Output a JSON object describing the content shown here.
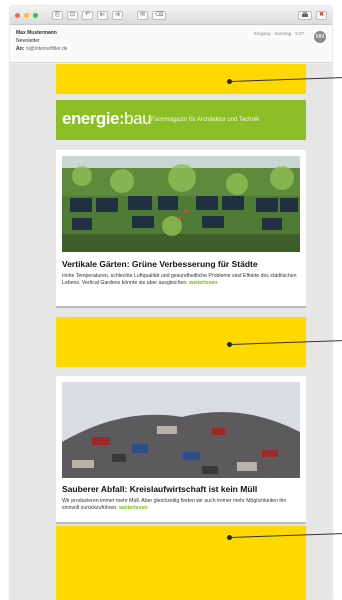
{
  "toolbar": {
    "lights": [
      "#ff5f57",
      "#ffbd2e",
      "#28c940"
    ],
    "buttons": [
      "⎘",
      "⊡",
      "↶",
      "⇇",
      "⇉",
      "✉",
      "⌫"
    ],
    "print_icon": "print-icon",
    "delete_icon": "delete-icon"
  },
  "header": {
    "sender": "Max Mustermann",
    "subject": "Newsletter",
    "to_label": "An:",
    "to_value": "ni@internetfilter.de",
    "meta": "Eingang · Sonntag · 9:37",
    "avatar": "MM"
  },
  "banner": {
    "logo_bold": "energie",
    "logo_sep": ":",
    "logo_light": "bau",
    "tagline": "Fachmagazin für Architektur und Technik",
    "color": "#8cbf26"
  },
  "articles": [
    {
      "title": "Vertikale Gärten: Grüne Verbesserung für Städte",
      "text": "Hohe Temperaturen, schlechte Luftqualität und gesundheitliche Probleme sind Effekte des städtischen Lebens. Vertical Gardens könnte sie aber ausgleichen.",
      "more": "weiterlesen"
    },
    {
      "title": "Sauberer Abfall: Kreislaufwirtschaft ist kein Müll",
      "text": "Wir produzieren immer mehr Müll. Aber gleichzeitig finden wir auch immer mehr Möglichkeiten ihn sinnvoll zurückzuführen.",
      "more": "weiterlesen"
    }
  ],
  "colors": {
    "ad_yellow": "#ffd800",
    "link_green": "#7eb321"
  }
}
